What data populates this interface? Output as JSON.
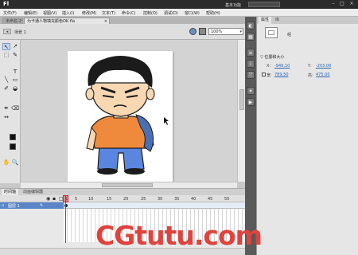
{
  "titlebar": {
    "logo": "Fl",
    "workspace": "基本功能",
    "search_placeholder": "",
    "minimize": "–",
    "maximize": "□",
    "close": "×"
  },
  "menu": {
    "items": [
      "文件(F)",
      "编辑(E)",
      "视图(V)",
      "插入(I)",
      "修改(M)",
      "文本(T)",
      "命令(C)",
      "控制(O)",
      "调试(D)",
      "窗口(W)",
      "帮助(H)"
    ]
  },
  "tabs": {
    "inactive": "未命名-2*",
    "active": "为卡通人物填充颜色OK.fla",
    "close": "×"
  },
  "editbar": {
    "back": "◂",
    "scene": "场景 1",
    "zoom": "100%",
    "zoom_arrow": "▾"
  },
  "toolbox": {
    "tools": [
      "↖",
      "↗",
      "⬚",
      "✎",
      "T",
      "╲",
      "▭",
      "✐",
      "◒",
      "✒",
      "⌫",
      "↔",
      "✋",
      "🔍"
    ]
  },
  "timeline": {
    "tabs": [
      "时间轴",
      "动画编辑器"
    ],
    "layer_name": "图层 1",
    "frame_numbers": [
      "1",
      "5",
      "10",
      "15",
      "20",
      "25",
      "30",
      "35",
      "40",
      "45",
      "50",
      "55",
      "60"
    ],
    "current_frame": 1
  },
  "properties": {
    "tabs": [
      "属性",
      "库"
    ],
    "instance_type": "组",
    "section_title": "▽ 位置和大小",
    "x_label": "X:",
    "x_value": "-949.10",
    "y_label": "Y:",
    "y_value": "-203.00",
    "w_label": "宽:",
    "w_value": "789.50",
    "h_label": "高:",
    "h_value": "475.00"
  },
  "watermark": {
    "text": "CGtutu.com"
  },
  "colors": {
    "shirt": "#ef8a3c",
    "pants": "#5a86e0",
    "hair": "#1b1b1b",
    "skin": "#f7d8b3",
    "cloth": "#4a6fb5",
    "watermark": "#e0423d",
    "playhead": "#dd2233",
    "selected_layer": "#5a86c8"
  }
}
